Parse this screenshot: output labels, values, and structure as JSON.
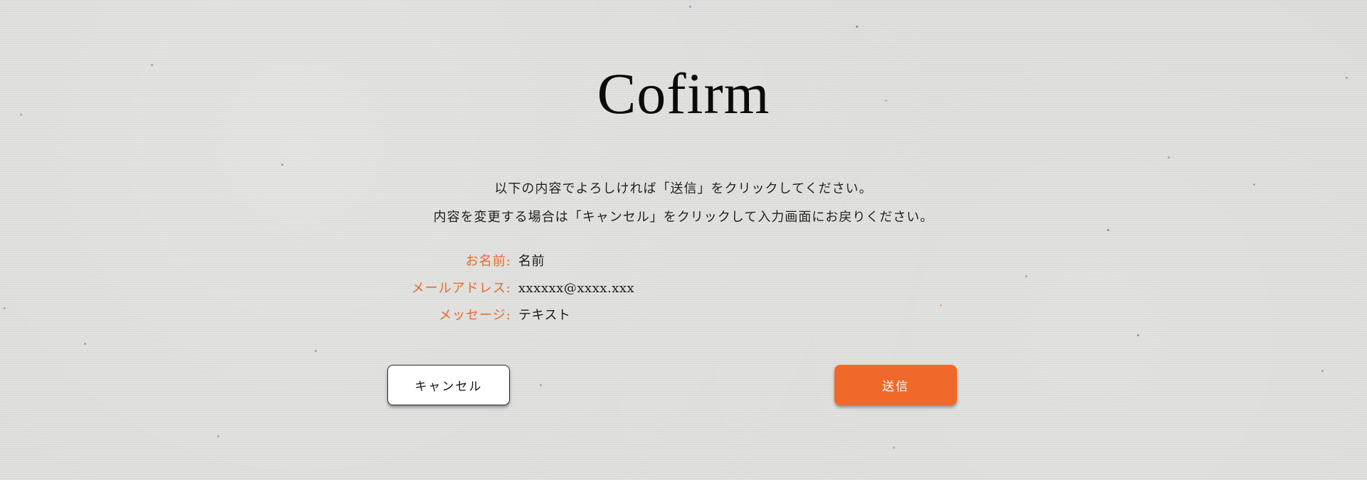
{
  "page": {
    "title": "Cofirm"
  },
  "instructions": {
    "line1": "以下の内容でよろしければ「送信」をクリックしてください。",
    "line2": "内容を変更する場合は「キャンセル」をクリックして入力画面にお戻りください。"
  },
  "fields": [
    {
      "label": "お名前:",
      "value": "名前"
    },
    {
      "label": "メールアドレス:",
      "value": "xxxxxx@xxxx.xxx"
    },
    {
      "label": "メッセージ:",
      "value": "テキスト"
    }
  ],
  "buttons": {
    "cancel_label": "キャンセル",
    "submit_label": "送信"
  },
  "colors": {
    "accent": "#f0692a",
    "label": "#e46a2e",
    "background": "#dcdcda"
  }
}
